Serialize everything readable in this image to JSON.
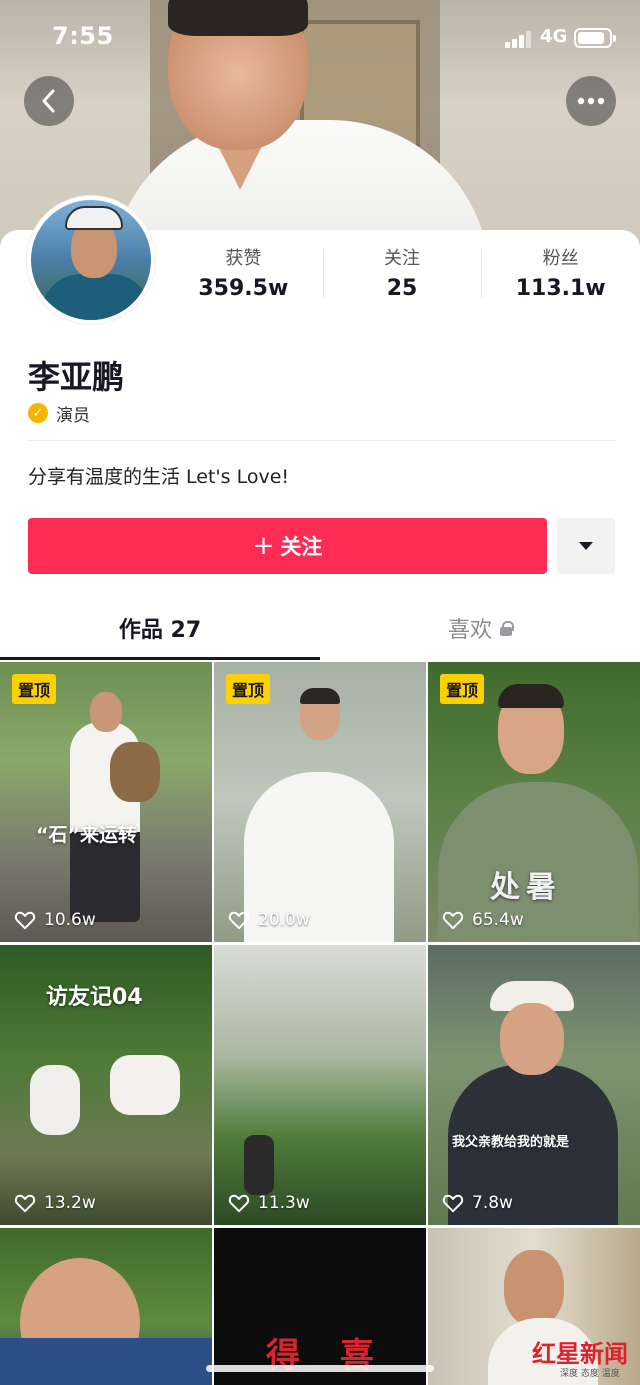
{
  "status_bar": {
    "time": "7:55",
    "network": "4G",
    "battery_level": 0.85
  },
  "profile": {
    "stats": [
      {
        "label": "获赞",
        "value": "359.5w"
      },
      {
        "label": "关注",
        "value": "25"
      },
      {
        "label": "粉丝",
        "value": "113.1w"
      }
    ],
    "name": "李亚鹏",
    "verified_label": "演员",
    "bio": "分享有温度的生活 Let's Love!"
  },
  "actions": {
    "follow_label": "关注",
    "dropdown_icon": "caret-down-icon"
  },
  "tabs": {
    "works_label": "作品 27",
    "likes_label": "喜欢"
  },
  "videos": [
    {
      "pinned_label": "置顶",
      "caption": "“石”来运转",
      "likes": "10.6w"
    },
    {
      "pinned_label": "置顶",
      "caption": "",
      "likes": "20.0w"
    },
    {
      "pinned_label": "置顶",
      "caption": "处暑",
      "likes": "65.4w"
    },
    {
      "caption": "访友记04",
      "likes": "13.2w"
    },
    {
      "caption": "",
      "likes": "11.3w"
    },
    {
      "caption": "我父亲教给我的就是",
      "likes": "7.8w"
    },
    {
      "caption": "",
      "likes": ""
    },
    {
      "caption": "得 喜",
      "likes": ""
    },
    {
      "caption": "",
      "likes": ""
    }
  ],
  "watermark": {
    "text": "红星新闻",
    "subtext": "深度 态度 温度"
  },
  "colors": {
    "accent": "#fe2c55",
    "pin_badge": "#fdd000",
    "verified_badge": "#f5b400"
  }
}
